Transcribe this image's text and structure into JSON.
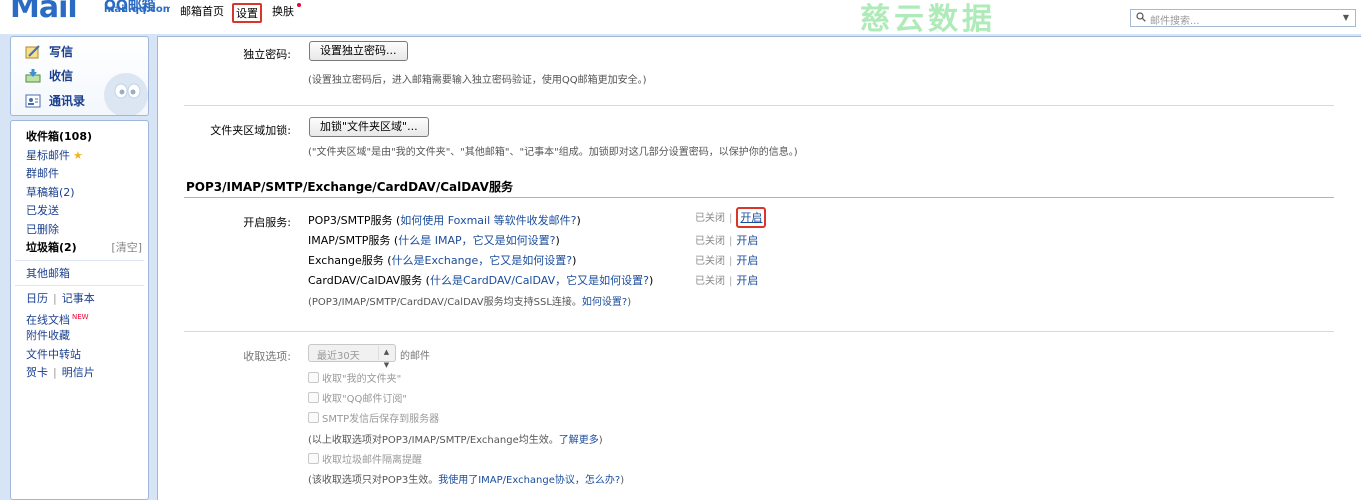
{
  "header": {
    "logo_text": "Mail",
    "logo_brand": "QQ邮箱",
    "logo_domain": "mail.qq.com",
    "nav": [
      "邮箱首页",
      "设置",
      "换肤"
    ],
    "watermark": "慈云数据",
    "search_placeholder": "邮件搜索..."
  },
  "sidebar": {
    "compose": "写信",
    "inbox": "收信",
    "contacts": "通讯录",
    "folders": [
      {
        "label": "收件箱(108)",
        "bold": true
      },
      {
        "label": "星标邮件"
      },
      {
        "label": "群邮件"
      },
      {
        "label": "草稿箱(2)"
      },
      {
        "label": "已发送"
      },
      {
        "label": "已删除"
      },
      {
        "label": "垃圾箱(2)",
        "bold": true,
        "extra": "[清空]"
      }
    ],
    "other": "其他邮箱",
    "calendar": "日历",
    "notes": "记事本",
    "docs": "在线文档",
    "docs_badge": "NEW",
    "attachments": "附件收藏",
    "transfer": "文件中转站",
    "card": "贺卡",
    "postcard": "明信片"
  },
  "main": {
    "pwd_label": "独立密码:",
    "pwd_button": "设置独立密码...",
    "pwd_hint": "(设置独立密码后，进入邮箱需要输入独立密码验证，使用QQ邮箱更加安全。)",
    "lock_label": "文件夹区域加锁:",
    "lock_button": "加锁\"文件夹区域\"...",
    "lock_hint": "(\"文件夹区域\"是由\"我的文件夹\"、\"其他邮箱\"、\"记事本\"组成。加锁即对这几部分设置密码，以保护你的信息。)",
    "section_title": "POP3/IMAP/SMTP/Exchange/CardDAV/CalDAV服务",
    "enable_label": "开启服务:",
    "services": [
      {
        "name": "POP3/SMTP服务 (",
        "link": "如何使用 Foxmail 等软件收发邮件?",
        "close": ")",
        "status": "已关闭",
        "action": "开启"
      },
      {
        "name": "IMAP/SMTP服务 (",
        "link": "什么是 IMAP，它又是如何设置?",
        "close": ")",
        "status": "已关闭",
        "action": "开启"
      },
      {
        "name": "Exchange服务 (",
        "link": "什么是Exchange，它又是如何设置?",
        "close": ")",
        "status": "已关闭",
        "action": "开启"
      },
      {
        "name": "CardDAV/CalDAV服务 (",
        "link": "什么是CardDAV/CalDAV，它又是如何设置?",
        "close": ")",
        "status": "已关闭",
        "action": "开启"
      }
    ],
    "ssl_hint": "(POP3/IMAP/SMTP/CardDAV/CalDAV服务均支持SSL连接。",
    "ssl_link": "如何设置?",
    "ssl_close": ")",
    "receive_label": "收取选项:",
    "receive_select": "最近30天",
    "receive_suffix": "的邮件",
    "checkboxes": [
      "收取\"我的文件夹\"",
      "收取\"QQ邮件订阅\"",
      "SMTP发信后保存到服务器"
    ],
    "receive_hint": "(以上收取选项对POP3/IMAP/SMTP/Exchange均生效。",
    "receive_link": "了解更多",
    "receive_close": ")",
    "spam_checkbox": "收取垃圾邮件隔离提醒",
    "pop3_hint": "(该收取选项只对POP3生效。",
    "pop3_link": "我使用了IMAP/Exchange协议，怎么办?",
    "pop3_close": ")"
  },
  "colors": {
    "link": "#1a4d9c",
    "highlight": "#d9352b",
    "panel_border": "#9fb7d9",
    "background": "#d6e4f5"
  }
}
